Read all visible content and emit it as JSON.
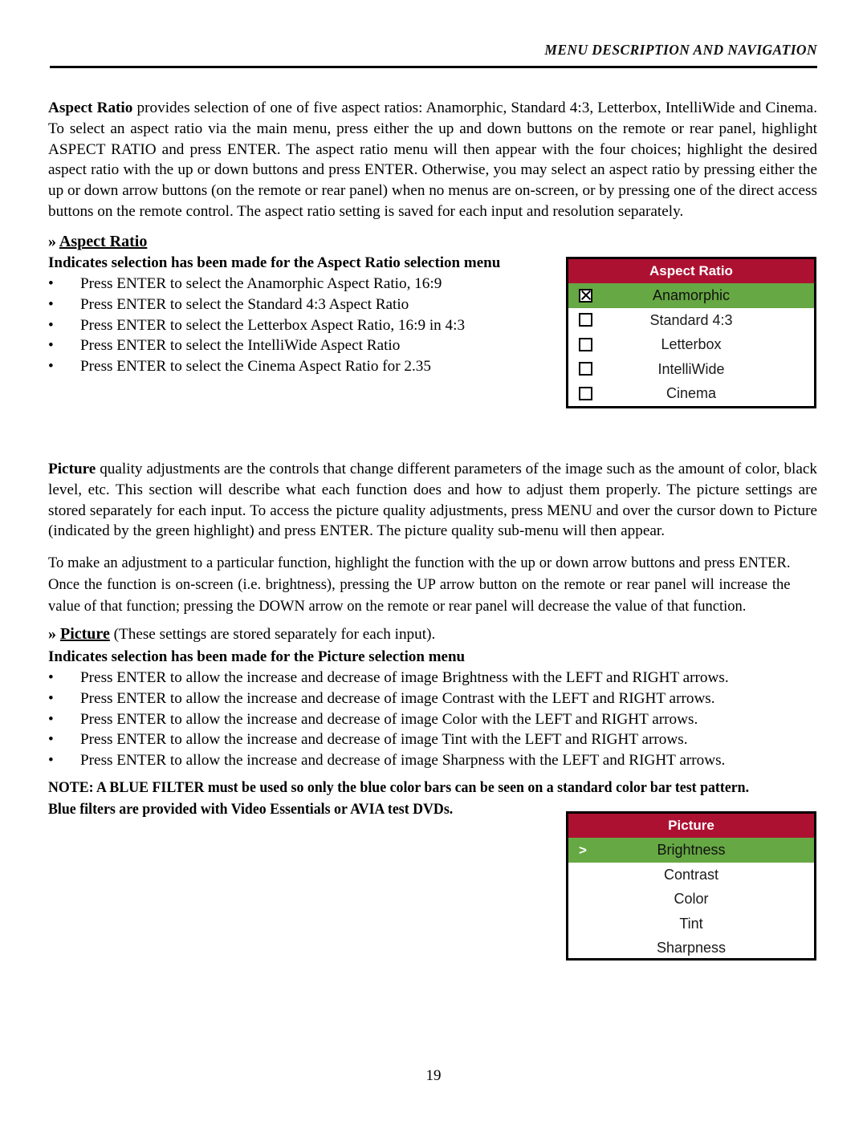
{
  "header": {
    "running_title": "MENU DESCRIPTION AND NAVIGATION"
  },
  "colors": {
    "menu_header_red": "#AD1132",
    "menu_highlight_green": "#66A843",
    "menu_background": "#FFFFFF",
    "menu_border": "#000000",
    "text": "#000000"
  },
  "aspect_ratio_section": {
    "intro_paragraph": {
      "lead_bold": "Aspect Ratio",
      "text": " provides selection of one of five aspect ratios: Anamorphic, Standard 4:3, Letterbox, IntelliWide and Cinema. To select an aspect ratio via the main menu, press either the up and down buttons on the remote or rear panel, highlight ASPECT RATIO and press ENTER. The aspect ratio menu will then appear with the four choices; highlight the desired aspect ratio with the up or down buttons and press ENTER. Otherwise, you may select an aspect ratio by pressing either the up or down arrow buttons (on the remote or rear panel) when no menus are on-screen, or by pressing one of the direct access buttons on the remote control. The aspect ratio setting is saved for each input and resolution separately."
    },
    "heading_marker": "»",
    "heading": "Aspect Ratio",
    "subheading": "Indicates selection has been made for the Aspect Ratio selection menu",
    "bullet_marker": "•",
    "bullets": [
      "Press ENTER to select the Anamorphic Aspect Ratio, 16:9",
      "Press ENTER to select the Standard 4:3 Aspect Ratio",
      "Press ENTER to select the Letterbox Aspect Ratio, 16:9 in 4:3",
      "Press ENTER to select the IntelliWide Aspect Ratio",
      "Press ENTER to select the Cinema Aspect Ratio for 2.35"
    ]
  },
  "aspect_ratio_menu": {
    "title": "Aspect Ratio",
    "items": [
      {
        "label": "Anamorphic",
        "checked": true,
        "selected": true
      },
      {
        "label": "Standard 4:3",
        "checked": false,
        "selected": false
      },
      {
        "label": "Letterbox",
        "checked": false,
        "selected": false
      },
      {
        "label": "IntelliWide",
        "checked": false,
        "selected": false
      },
      {
        "label": "Cinema",
        "checked": false,
        "selected": false
      }
    ]
  },
  "picture_section": {
    "intro_paragraph": {
      "lead_bold": "Picture",
      "text": " quality adjustments  are the controls that change different parameters of the image such as the amount of color, black level, etc. This section will describe what each function does and how to adjust them properly. The picture settings are stored separately for each input. To access the picture quality adjustments, press MENU and over the cursor down to Picture (indicated by the green highlight) and press ENTER. The picture quality sub-menu will then appear."
    },
    "second_paragraph": "To make an adjustment to a particular function, highlight the function with the up or down arrow buttons and press ENTER. Once the function is on-screen (i.e. brightness), pressing the UP arrow button on the remote or rear panel will increase the value of that function; pressing the DOWN arrow on the remote or rear panel will decrease the value of that function.",
    "heading_marker": "»",
    "heading": "Picture",
    "heading_suffix": " (These settings are stored separately for each input).",
    "subheading": "Indicates selection has been made for the Picture selection menu",
    "bullet_marker": "•",
    "bullets": [
      "Press ENTER to allow the increase and decrease of image Brightness with the LEFT and RIGHT arrows.",
      "Press ENTER to allow the increase and decrease of image Contrast with the LEFT and RIGHT arrows.",
      "Press ENTER to allow the increase and decrease of image Color with the LEFT and RIGHT arrows.",
      "Press ENTER to allow the increase and decrease of image Tint with the LEFT and RIGHT arrows.",
      "Press ENTER to allow the increase and decrease of image Sharpness with the LEFT and RIGHT arrows."
    ],
    "note_line_1": "NOTE: A BLUE FILTER must be used so only the blue color bars can be seen on a standard color bar test pattern.",
    "note_line_2": "Blue filters are provided with Video Essentials or AVIA test DVDs."
  },
  "picture_menu": {
    "title": "Picture",
    "selection_marker": ">",
    "items": [
      {
        "label": "Brightness",
        "selected": true
      },
      {
        "label": "Contrast",
        "selected": false
      },
      {
        "label": "Color",
        "selected": false
      },
      {
        "label": "Tint",
        "selected": false
      },
      {
        "label": "Sharpness",
        "selected": false
      }
    ]
  },
  "footer": {
    "page_number": "19"
  }
}
